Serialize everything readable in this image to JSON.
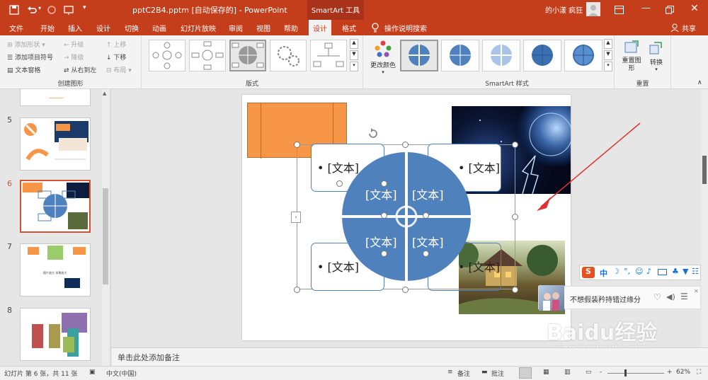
{
  "title": {
    "filename": "pptC2B4.pptm",
    "autosave": "[自动保存的]",
    "separator": " - ",
    "app": "PowerPoint",
    "context": "SmartArt 工具",
    "user": "的小漾 疯狂"
  },
  "tabs": [
    "文件",
    "开始",
    "插入",
    "设计",
    "切换",
    "动画",
    "幻灯片放映",
    "审阅",
    "视图",
    "帮助",
    "设计",
    "格式"
  ],
  "active_tab": "设计",
  "tellme": "操作说明搜索",
  "share": "共享",
  "ribbon": {
    "create": {
      "add_shape": "添加形状",
      "add_bullet": "添加项目符号",
      "text_pane": "文本窗格",
      "promote": "升级",
      "demote": "降级",
      "rtl": "从右到左",
      "move_up": "上移",
      "move_down": "下移",
      "layout": "布局",
      "label": "创建图形"
    },
    "layouts_label": "版式",
    "change_colors": "更改颜色",
    "styles_label": "SmartArt 样式",
    "reset_graphic": "重置图形",
    "convert": "转换",
    "reset_label": "重置"
  },
  "slides": {
    "numbers": [
      "5",
      "6",
      "7",
      "8"
    ],
    "slide7_caption": "图片放大    场景放大"
  },
  "smartart": {
    "bullet_texts": [
      "• [文本]",
      "• [文本]",
      "• [文本]",
      "• [文本]"
    ],
    "quadrant_texts": [
      "[文本]",
      "[文本]",
      "[文本]",
      "[文本]"
    ]
  },
  "notes_placeholder": "单击此处添加备注",
  "status": {
    "slide_info": "幻灯片 第 6 张，共 11 张",
    "language": "中文(中国)",
    "notes_btn": "备注",
    "comments_btn": "批注",
    "zoom_minus": "-",
    "zoom_plus": "+",
    "zoom": "62%"
  },
  "ime": {
    "logo": "S",
    "mode": "中",
    "song": "不想假装矜持错过缘分"
  },
  "watermark": {
    "brand": "Baidu经验",
    "url": "jingyan.baidu.com"
  },
  "colors": {
    "accent": "#c43e1c",
    "smartart_blue": "#4f81bd",
    "orange_shape": "#f79646",
    "arrow_red": "#e03030"
  }
}
